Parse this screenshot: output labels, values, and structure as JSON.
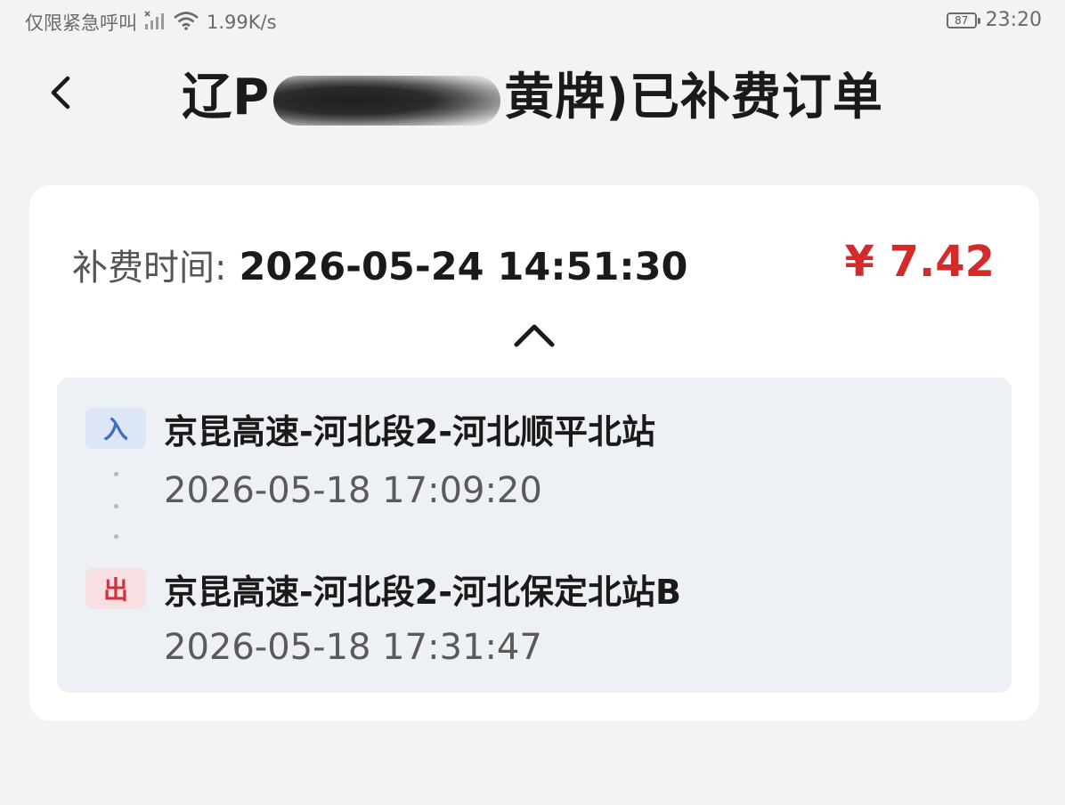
{
  "status_bar": {
    "left_text": "仅限紧急呼叫",
    "network_speed": "1.99K/s",
    "battery": "87",
    "time": "23:20",
    "icons": [
      "signal-icon",
      "wifi-icon",
      "battery-icon"
    ]
  },
  "nav": {
    "back_icon": "chevron-left-icon",
    "title_prefix": "辽P",
    "title_suffix": "黄牌)已补费订单"
  },
  "order": {
    "time_label": "补费时间:",
    "time_value": "2026-05-24 14:51:30",
    "amount": "¥ 7.42",
    "collapse_icon": "chevron-up-icon"
  },
  "trip": {
    "entry": {
      "badge": "入",
      "station": "京昆高速-河北段2-河北顺平北站",
      "time": "2026-05-18 17:09:20"
    },
    "exit": {
      "badge": "出",
      "station": "京昆高速-河北段2-河北保定北站B",
      "time": "2026-05-18 17:31:47"
    }
  },
  "colors": {
    "background": "#f2f3f5",
    "card": "#ffffff",
    "panel": "#edf0f4",
    "amount": "#d42a2a",
    "entry_badge_text": "#3e6fc0",
    "entry_badge_bg": "#dce6f5",
    "exit_badge_text": "#d0333c",
    "exit_badge_bg": "#f6e0e2"
  }
}
